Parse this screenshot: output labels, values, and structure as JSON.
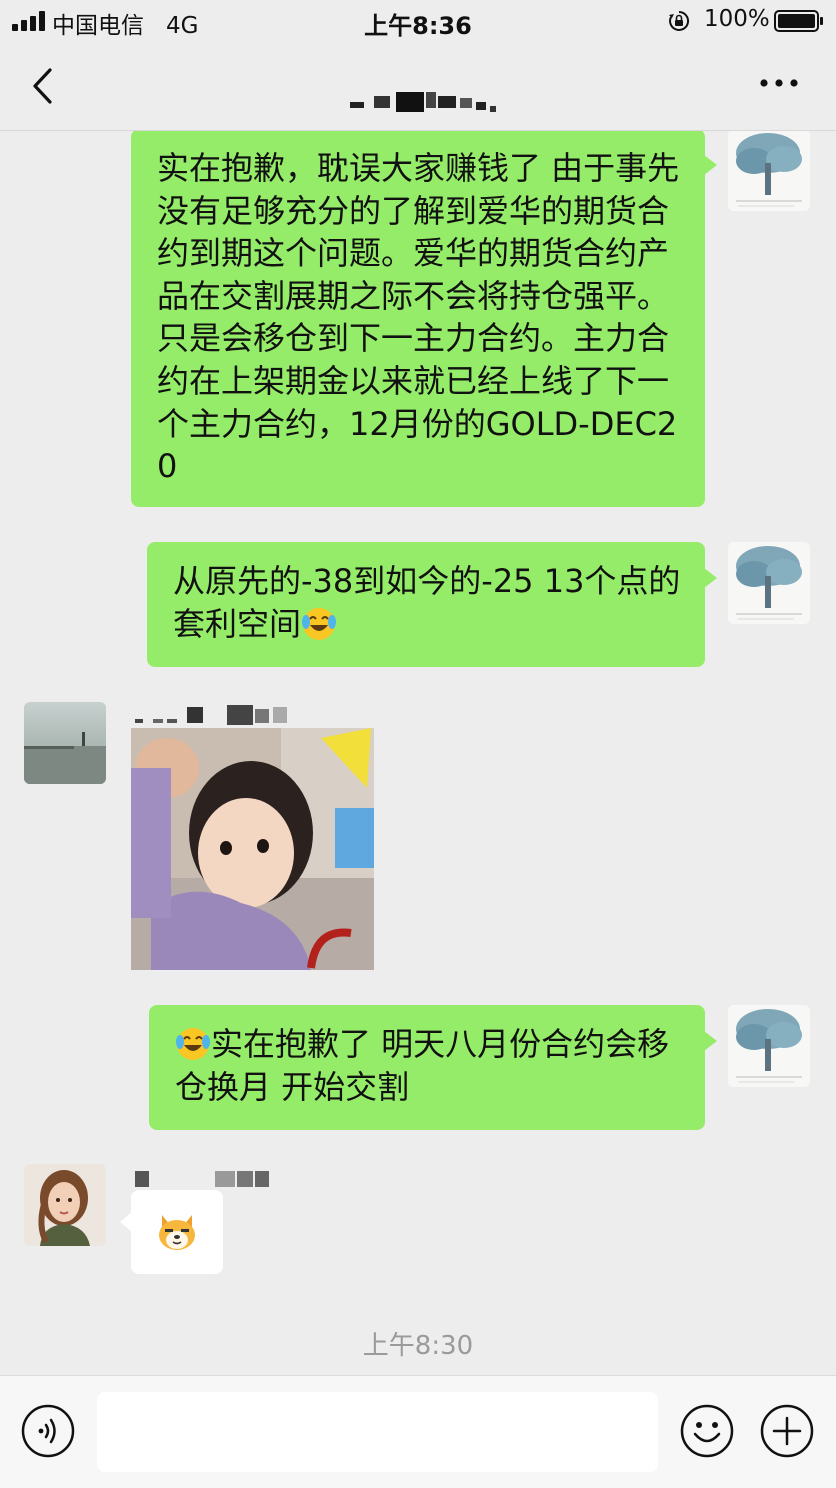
{
  "status_bar": {
    "carrier": "中国电信",
    "network": "4G",
    "time": "上午8:36",
    "battery_percent": "100%"
  },
  "chat": {
    "title": "",
    "messages": [
      {
        "side": "right",
        "text": "实在抱歉，耽误大家赚钱了 由于事先没有足够充分的了解到爱华的期货合约到期这个问题。爱华的期货合约产品在交割展期之际不会将持仓强平。只是会移仓到下一主力合约。主力合约在上架期金以来就已经上线了下一个主力合约，12月份的GOLD-DEC20"
      },
      {
        "side": "right",
        "text": "从原先的-38到如今的-25 13个点的套利空间",
        "emoji_after": "laughing-crying"
      },
      {
        "side": "left",
        "type": "image",
        "description_icon": "child-photo"
      },
      {
        "side": "right",
        "emoji_before": "laughing-crying",
        "text": "实在抱歉了 明天八月份合约会移仓换月 开始交割"
      },
      {
        "side": "left",
        "type": "sticker",
        "description_icon": "doge-sticker"
      }
    ],
    "timestamp": "上午8:30"
  },
  "input_bar": {
    "placeholder": "",
    "value": ""
  },
  "colors": {
    "bubble_green": "#95ec69",
    "background": "#ededed"
  }
}
